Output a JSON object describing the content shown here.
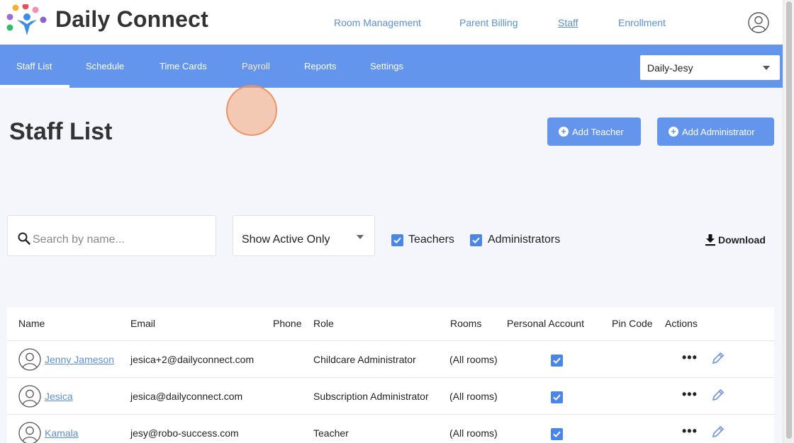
{
  "brand": {
    "name": "Daily Connect"
  },
  "top_nav": [
    {
      "label": "Room Management",
      "active": false
    },
    {
      "label": "Parent Billing",
      "active": false
    },
    {
      "label": "Staff",
      "active": true
    },
    {
      "label": "Enrollment",
      "active": false
    }
  ],
  "sub_nav": {
    "tabs": [
      {
        "label": "Staff List",
        "active": true
      },
      {
        "label": "Schedule",
        "active": false
      },
      {
        "label": "Time Cards",
        "active": false
      },
      {
        "label": "Payroll",
        "active": false
      },
      {
        "label": "Reports",
        "active": false
      },
      {
        "label": "Settings",
        "active": false
      }
    ],
    "site_select": {
      "value": "Daily-Jesy"
    }
  },
  "page": {
    "title": "Staff List",
    "add_teacher_label": "Add Teacher",
    "add_admin_label": "Add Administrator"
  },
  "filters": {
    "search_placeholder": "Search by name...",
    "status_value": "Show Active Only",
    "teachers_label": "Teachers",
    "teachers_checked": true,
    "admins_label": "Administrators",
    "admins_checked": true,
    "download_label": "Download"
  },
  "table": {
    "headers": [
      "Name",
      "Email",
      "Phone",
      "Role",
      "Rooms",
      "Personal Account",
      "Pin Code",
      "Actions"
    ],
    "rows": [
      {
        "name": "Jenny Jameson",
        "email": "jesica+2@dailyconnect.com",
        "phone": "",
        "role": "Childcare Administrator",
        "rooms": "(All rooms)",
        "personal_account": true,
        "pin": ""
      },
      {
        "name": "Jesica",
        "email": "jesica@dailyconnect.com",
        "phone": "",
        "role": "Subscription Administrator",
        "rooms": "(All rooms)",
        "personal_account": true,
        "pin": ""
      },
      {
        "name": "Kamala",
        "email": "jesy@robo-success.com",
        "phone": "",
        "role": "Teacher",
        "rooms": "(All rooms)",
        "personal_account": true,
        "pin": ""
      }
    ],
    "more_glyph": "•••"
  },
  "colors": {
    "primary": "#6495ed",
    "link": "#5b8fd9",
    "checkbox": "#4a86e8",
    "highlight": "#f4a478"
  }
}
